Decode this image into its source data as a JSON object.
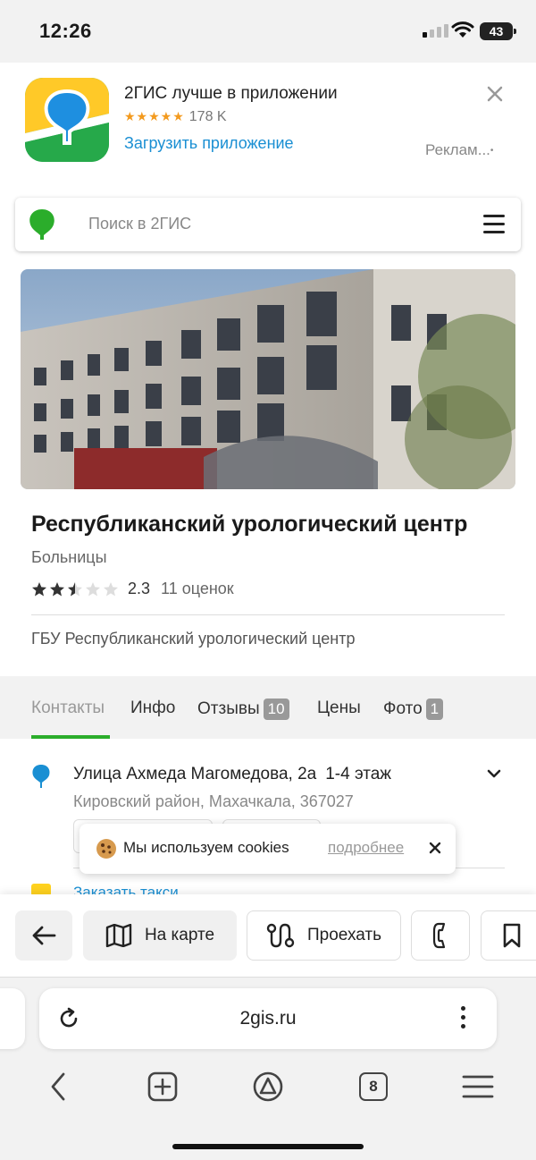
{
  "status_bar": {
    "time": "12:26",
    "battery": "43"
  },
  "app_banner": {
    "title": "2ГИС лучше в приложении",
    "stars": "★★★★★",
    "rating_count": "178 K",
    "install_link": "Загрузить приложение",
    "ad_label": "Реклам...",
    "ad_dot": "•"
  },
  "search": {
    "placeholder": "Поиск в 2ГИС"
  },
  "place": {
    "title": "Республиканский урологический центр",
    "category": "Больницы",
    "rating_value": 2.3,
    "rating_text": "2.3",
    "ratings_count": "11 оценок",
    "organization": "ГБУ Республиканский урологический центр"
  },
  "tabs": [
    {
      "label": "Контакты",
      "badge": ""
    },
    {
      "label": "Инфо",
      "badge": ""
    },
    {
      "label": "Отзывы",
      "badge": "10"
    },
    {
      "label": "Цены",
      "badge": ""
    },
    {
      "label": "Фото",
      "badge": "1"
    }
  ],
  "address": {
    "street": "Улица Ахмеда Магомедова, 2а",
    "floor": "1-4 этаж",
    "district": "Кировский район, Махачкала, 367027"
  },
  "taxi": {
    "label": "Заказать такси"
  },
  "cookie_notice": {
    "emoji": "🍪",
    "text": "Мы используем cookies",
    "link": "подробнее"
  },
  "actions": {
    "map_label": "На карте",
    "route_label": "Проехать"
  },
  "browser": {
    "url": "2gis.ru",
    "tabs_count": "8"
  },
  "colors": {
    "brand_green": "#2bad2b",
    "link_blue": "#1a8fd3",
    "star_orange": "#f39a1e"
  }
}
